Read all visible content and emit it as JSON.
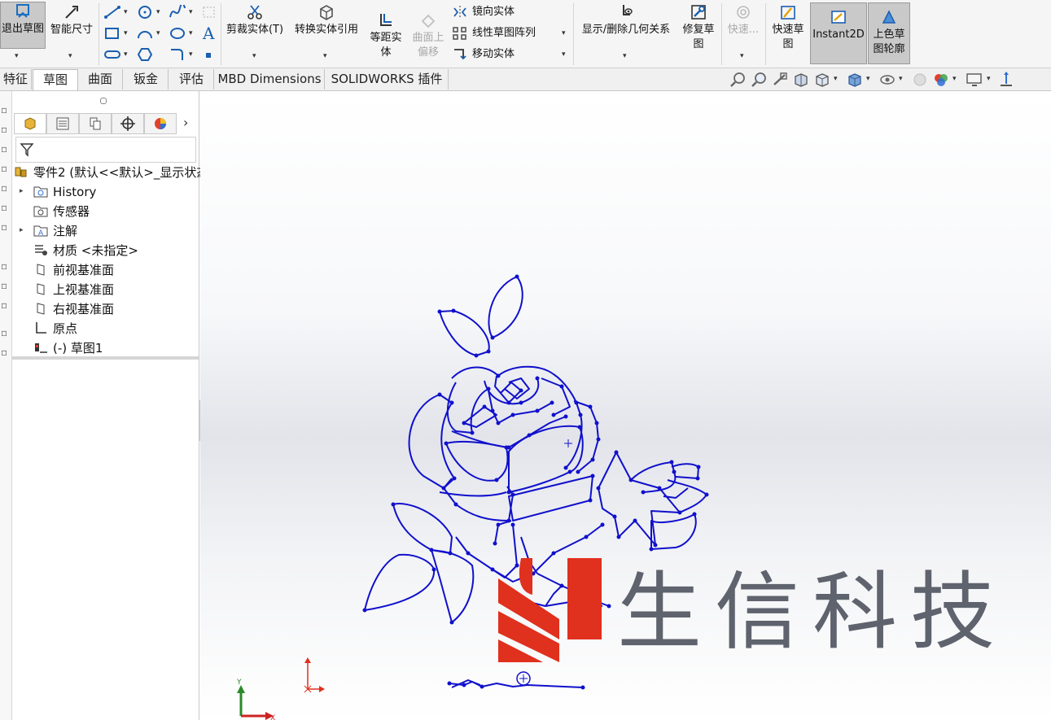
{
  "ribbon": {
    "exit_sketch": "退出草图",
    "smart_dimension": "智能尺寸",
    "trim_entities": "剪裁实体(T)",
    "convert_entities": "转换实体引用",
    "offset_entities_a": "等距实",
    "offset_entities_b": "体",
    "offset_on_surface_a": "曲面上",
    "offset_on_surface_b": "偏移",
    "mirror_entities": "镜向实体",
    "linear_pattern": "线性草图阵列",
    "move_entities": "移动实体",
    "display_delete_relations": "显示/删除几何关系",
    "repair_sketch_a": "修复草",
    "repair_sketch_b": "图",
    "quick_snaps": "快速...",
    "rapid_sketch_a": "快速草",
    "rapid_sketch_b": "图",
    "instant2d": "Instant2D",
    "shaded_contours_a": "上色草",
    "shaded_contours_b": "图轮廓"
  },
  "tabs": [
    "特征",
    "草图",
    "曲面",
    "钣金",
    "评估",
    "MBD Dimensions",
    "SOLIDWORKS 插件"
  ],
  "active_tab": "草图",
  "tree": {
    "root": "零件2  (默认<<默认>_显示状态",
    "items": [
      "History",
      "传感器",
      "注解",
      "材质 <未指定>",
      "前视基准面",
      "上视基准面",
      "右视基准面",
      "原点",
      "(-) 草图1"
    ]
  },
  "watermark": "生信科技",
  "colors": {
    "sketch": "#1010cc",
    "logo_red": "#e0301e",
    "watermark_gray": "#5e636d",
    "accent_active": "#c9c9c9"
  },
  "icons": [
    "sketch-icon",
    "smart-dimension-icon",
    "line-icon",
    "circle-icon",
    "spline-icon",
    "rectangle-icon",
    "arc-icon",
    "text-icon",
    "slot-icon",
    "polygon-icon",
    "fillet-icon",
    "point-icon",
    "trim-icon",
    "convert-icon",
    "offset-icon",
    "mirror-icon",
    "pattern-icon",
    "move-icon",
    "relations-icon",
    "repair-icon",
    "snap-icon",
    "rapid-sketch-icon",
    "instant2d-icon",
    "shaded-contour-icon"
  ]
}
